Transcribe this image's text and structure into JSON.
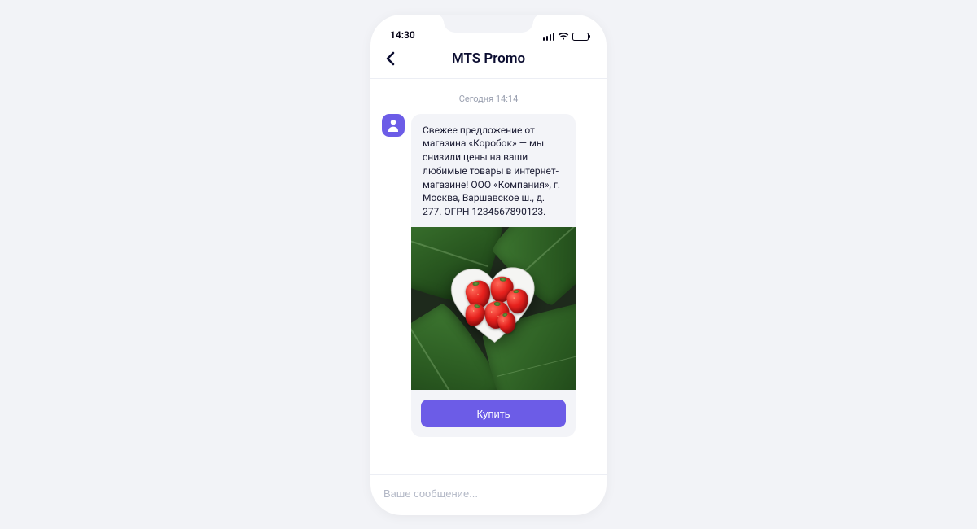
{
  "statusbar": {
    "time": "14:30"
  },
  "nav": {
    "title": "MTS Promo"
  },
  "thread": {
    "day_label": "Сегодня 14:14",
    "message": {
      "text": "Свежее предложение от магазина «Коробок» — мы снизили цены на ваши любимые товары в интернет-магазине! ООО «Компания», г. Москва, Варшавское ш., д. 277. ОГРН 1234567890123.",
      "image_alt": "strawberries-in-heart-bowl",
      "cta_label": "Купить"
    }
  },
  "composer": {
    "placeholder": "Ваше сообщение..."
  }
}
